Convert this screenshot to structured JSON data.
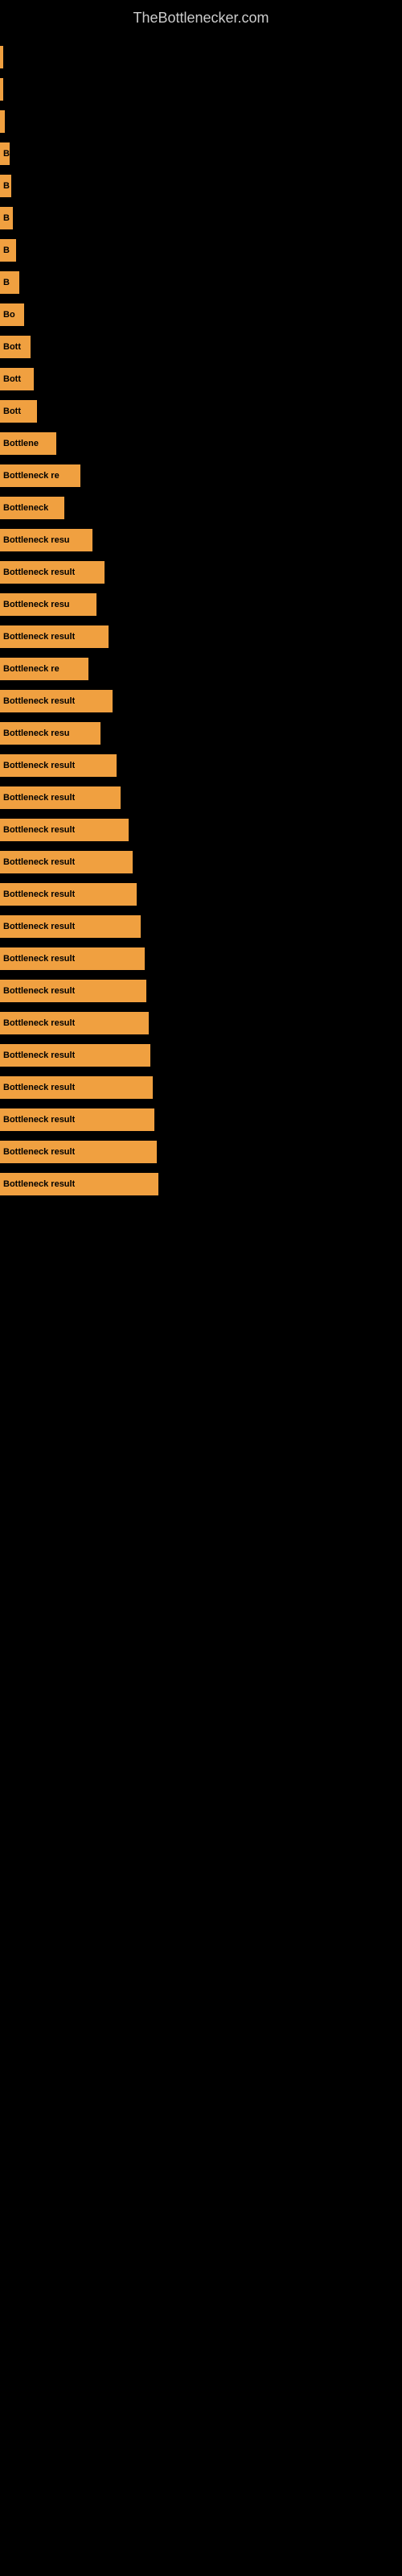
{
  "header": {
    "title": "TheBottlenecker.com"
  },
  "bars": [
    {
      "label": "",
      "width": 2
    },
    {
      "label": "",
      "width": 4
    },
    {
      "label": "",
      "width": 6
    },
    {
      "label": "B",
      "width": 12
    },
    {
      "label": "B",
      "width": 14
    },
    {
      "label": "B",
      "width": 16
    },
    {
      "label": "B",
      "width": 20
    },
    {
      "label": "B",
      "width": 24
    },
    {
      "label": "Bo",
      "width": 30
    },
    {
      "label": "Bott",
      "width": 38
    },
    {
      "label": "Bott",
      "width": 42
    },
    {
      "label": "Bott",
      "width": 46
    },
    {
      "label": "Bottlene",
      "width": 70
    },
    {
      "label": "Bottleneck re",
      "width": 100
    },
    {
      "label": "Bottleneck",
      "width": 80
    },
    {
      "label": "Bottleneck resu",
      "width": 115
    },
    {
      "label": "Bottleneck result",
      "width": 130
    },
    {
      "label": "Bottleneck resu",
      "width": 120
    },
    {
      "label": "Bottleneck result",
      "width": 135
    },
    {
      "label": "Bottleneck re",
      "width": 110
    },
    {
      "label": "Bottleneck result",
      "width": 140
    },
    {
      "label": "Bottleneck resu",
      "width": 125
    },
    {
      "label": "Bottleneck result",
      "width": 145
    },
    {
      "label": "Bottleneck result",
      "width": 150
    },
    {
      "label": "Bottleneck result",
      "width": 160
    },
    {
      "label": "Bottleneck result",
      "width": 165
    },
    {
      "label": "Bottleneck result",
      "width": 170
    },
    {
      "label": "Bottleneck result",
      "width": 175
    },
    {
      "label": "Bottleneck result",
      "width": 180
    },
    {
      "label": "Bottleneck result",
      "width": 182
    },
    {
      "label": "Bottleneck result",
      "width": 185
    },
    {
      "label": "Bottleneck result",
      "width": 187
    },
    {
      "label": "Bottleneck result",
      "width": 190
    },
    {
      "label": "Bottleneck result",
      "width": 192
    },
    {
      "label": "Bottleneck result",
      "width": 195
    },
    {
      "label": "Bottleneck result",
      "width": 197
    }
  ]
}
